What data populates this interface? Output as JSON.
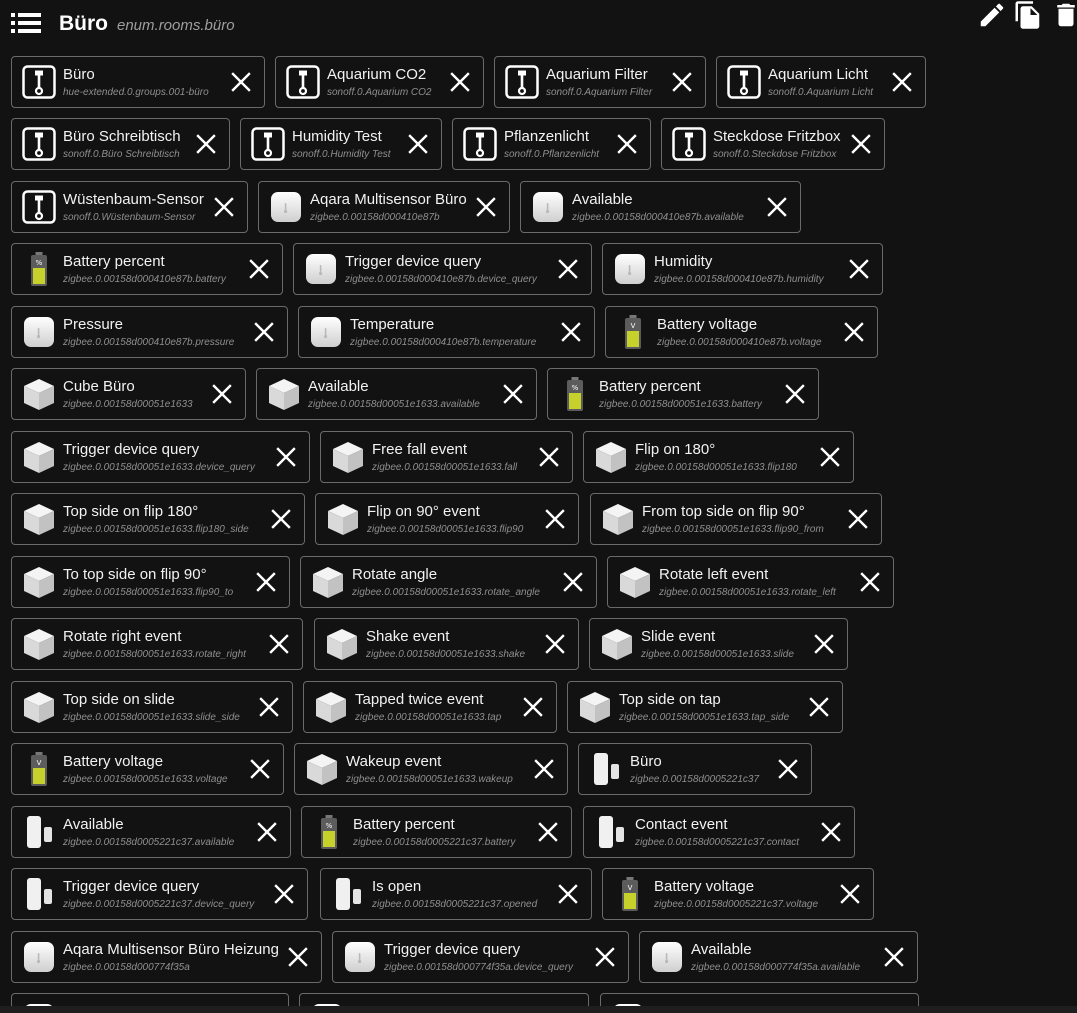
{
  "header": {
    "title": "Büro",
    "subtitle": "enum.rooms.büro"
  },
  "colors": {
    "background": "#121212",
    "card_border": "#6a6a6a",
    "battery_green": "#c6d12b",
    "muted_text": "#8f8f8f"
  },
  "icons": {
    "menu": "menu-icon",
    "edit": "pencil-icon",
    "copy": "copy-icon",
    "delete": "trash-icon",
    "remove": "close-icon"
  },
  "members": [
    {
      "name": "Büro",
      "id": "hue-extended.0.groups.001-büro",
      "icon": "socket"
    },
    {
      "name": "Aquarium CO2",
      "id": "sonoff.0.Aquarium CO2",
      "icon": "socket"
    },
    {
      "name": "Aquarium Filter",
      "id": "sonoff.0.Aquarium Filter",
      "icon": "socket"
    },
    {
      "name": "Aquarium Licht",
      "id": "sonoff.0.Aquarium Licht",
      "icon": "socket"
    },
    {
      "name": "Büro Schreibtisch",
      "id": "sonoff.0.Büro Schreibtisch",
      "icon": "socket"
    },
    {
      "name": "Humidity Test",
      "id": "sonoff.0.Humidity Test",
      "icon": "socket"
    },
    {
      "name": "Pflanzenlicht",
      "id": "sonoff.0.Pflanzenlicht",
      "icon": "socket"
    },
    {
      "name": "Steckdose Fritzbox",
      "id": "sonoff.0.Steckdose Fritzbox",
      "icon": "socket"
    },
    {
      "name": "Wüstenbaum-Sensor",
      "id": "sonoff.0.Wüstenbaum-Sensor",
      "icon": "socket"
    },
    {
      "name": "Aqara Multisensor Büro",
      "id": "zigbee.0.00158d000410e87b",
      "icon": "sensor"
    },
    {
      "name": "Available",
      "id": "zigbee.0.00158d000410e87b.available",
      "icon": "sensor"
    },
    {
      "name": "Battery percent",
      "id": "zigbee.0.00158d000410e87b.battery",
      "icon": "battery-percent"
    },
    {
      "name": "Trigger device query",
      "id": "zigbee.0.00158d000410e87b.device_query",
      "icon": "sensor"
    },
    {
      "name": "Humidity",
      "id": "zigbee.0.00158d000410e87b.humidity",
      "icon": "sensor"
    },
    {
      "name": "Pressure",
      "id": "zigbee.0.00158d000410e87b.pressure",
      "icon": "sensor"
    },
    {
      "name": "Temperature",
      "id": "zigbee.0.00158d000410e87b.temperature",
      "icon": "sensor"
    },
    {
      "name": "Battery voltage",
      "id": "zigbee.0.00158d000410e87b.voltage",
      "icon": "battery-voltage"
    },
    {
      "name": "Cube Büro",
      "id": "zigbee.0.00158d00051e1633",
      "icon": "cube"
    },
    {
      "name": "Available",
      "id": "zigbee.0.00158d00051e1633.available",
      "icon": "cube"
    },
    {
      "name": "Battery percent",
      "id": "zigbee.0.00158d00051e1633.battery",
      "icon": "battery-percent"
    },
    {
      "name": "Trigger device query",
      "id": "zigbee.0.00158d00051e1633.device_query",
      "icon": "cube"
    },
    {
      "name": "Free fall event",
      "id": "zigbee.0.00158d00051e1633.fall",
      "icon": "cube"
    },
    {
      "name": "Flip on 180°",
      "id": "zigbee.0.00158d00051e1633.flip180",
      "icon": "cube"
    },
    {
      "name": "Top side on flip 180°",
      "id": "zigbee.0.00158d00051e1633.flip180_side",
      "icon": "cube"
    },
    {
      "name": "Flip on 90° event",
      "id": "zigbee.0.00158d00051e1633.flip90",
      "icon": "cube"
    },
    {
      "name": "From top side on flip 90°",
      "id": "zigbee.0.00158d00051e1633.flip90_from",
      "icon": "cube"
    },
    {
      "name": "To top side on flip 90°",
      "id": "zigbee.0.00158d00051e1633.flip90_to",
      "icon": "cube"
    },
    {
      "name": "Rotate angle",
      "id": "zigbee.0.00158d00051e1633.rotate_angle",
      "icon": "cube"
    },
    {
      "name": "Rotate left event",
      "id": "zigbee.0.00158d00051e1633.rotate_left",
      "icon": "cube"
    },
    {
      "name": "Rotate right event",
      "id": "zigbee.0.00158d00051e1633.rotate_right",
      "icon": "cube"
    },
    {
      "name": "Shake event",
      "id": "zigbee.0.00158d00051e1633.shake",
      "icon": "cube"
    },
    {
      "name": "Slide event",
      "id": "zigbee.0.00158d00051e1633.slide",
      "icon": "cube"
    },
    {
      "name": "Top side on slide",
      "id": "zigbee.0.00158d00051e1633.slide_side",
      "icon": "cube"
    },
    {
      "name": "Tapped twice event",
      "id": "zigbee.0.00158d00051e1633.tap",
      "icon": "cube"
    },
    {
      "name": "Top side on tap",
      "id": "zigbee.0.00158d00051e1633.tap_side",
      "icon": "cube"
    },
    {
      "name": "Battery voltage",
      "id": "zigbee.0.00158d00051e1633.voltage",
      "icon": "battery-voltage"
    },
    {
      "name": "Wakeup event",
      "id": "zigbee.0.00158d00051e1633.wakeup",
      "icon": "cube"
    },
    {
      "name": "Büro",
      "id": "zigbee.0.00158d0005221c37",
      "icon": "contact"
    },
    {
      "name": "Available",
      "id": "zigbee.0.00158d0005221c37.available",
      "icon": "contact"
    },
    {
      "name": "Battery percent",
      "id": "zigbee.0.00158d0005221c37.battery",
      "icon": "battery-percent"
    },
    {
      "name": "Contact event",
      "id": "zigbee.0.00158d0005221c37.contact",
      "icon": "contact"
    },
    {
      "name": "Trigger device query",
      "id": "zigbee.0.00158d0005221c37.device_query",
      "icon": "contact"
    },
    {
      "name": "Is open",
      "id": "zigbee.0.00158d0005221c37.opened",
      "icon": "contact"
    },
    {
      "name": "Battery voltage",
      "id": "zigbee.0.00158d0005221c37.voltage",
      "icon": "battery-voltage"
    },
    {
      "name": "Aqara Multisensor Büro Heizung",
      "id": "zigbee.0.00158d000774f35a",
      "icon": "sensor"
    },
    {
      "name": "Trigger device query",
      "id": "zigbee.0.00158d000774f35a.device_query",
      "icon": "sensor"
    },
    {
      "name": "Available",
      "id": "zigbee.0.00158d000774f35a.available",
      "icon": "sensor"
    },
    {
      "name": "",
      "id": "",
      "icon": "sensor"
    },
    {
      "name": "",
      "id": "",
      "icon": "sensor"
    },
    {
      "name": "",
      "id": "",
      "icon": "sensor"
    }
  ]
}
